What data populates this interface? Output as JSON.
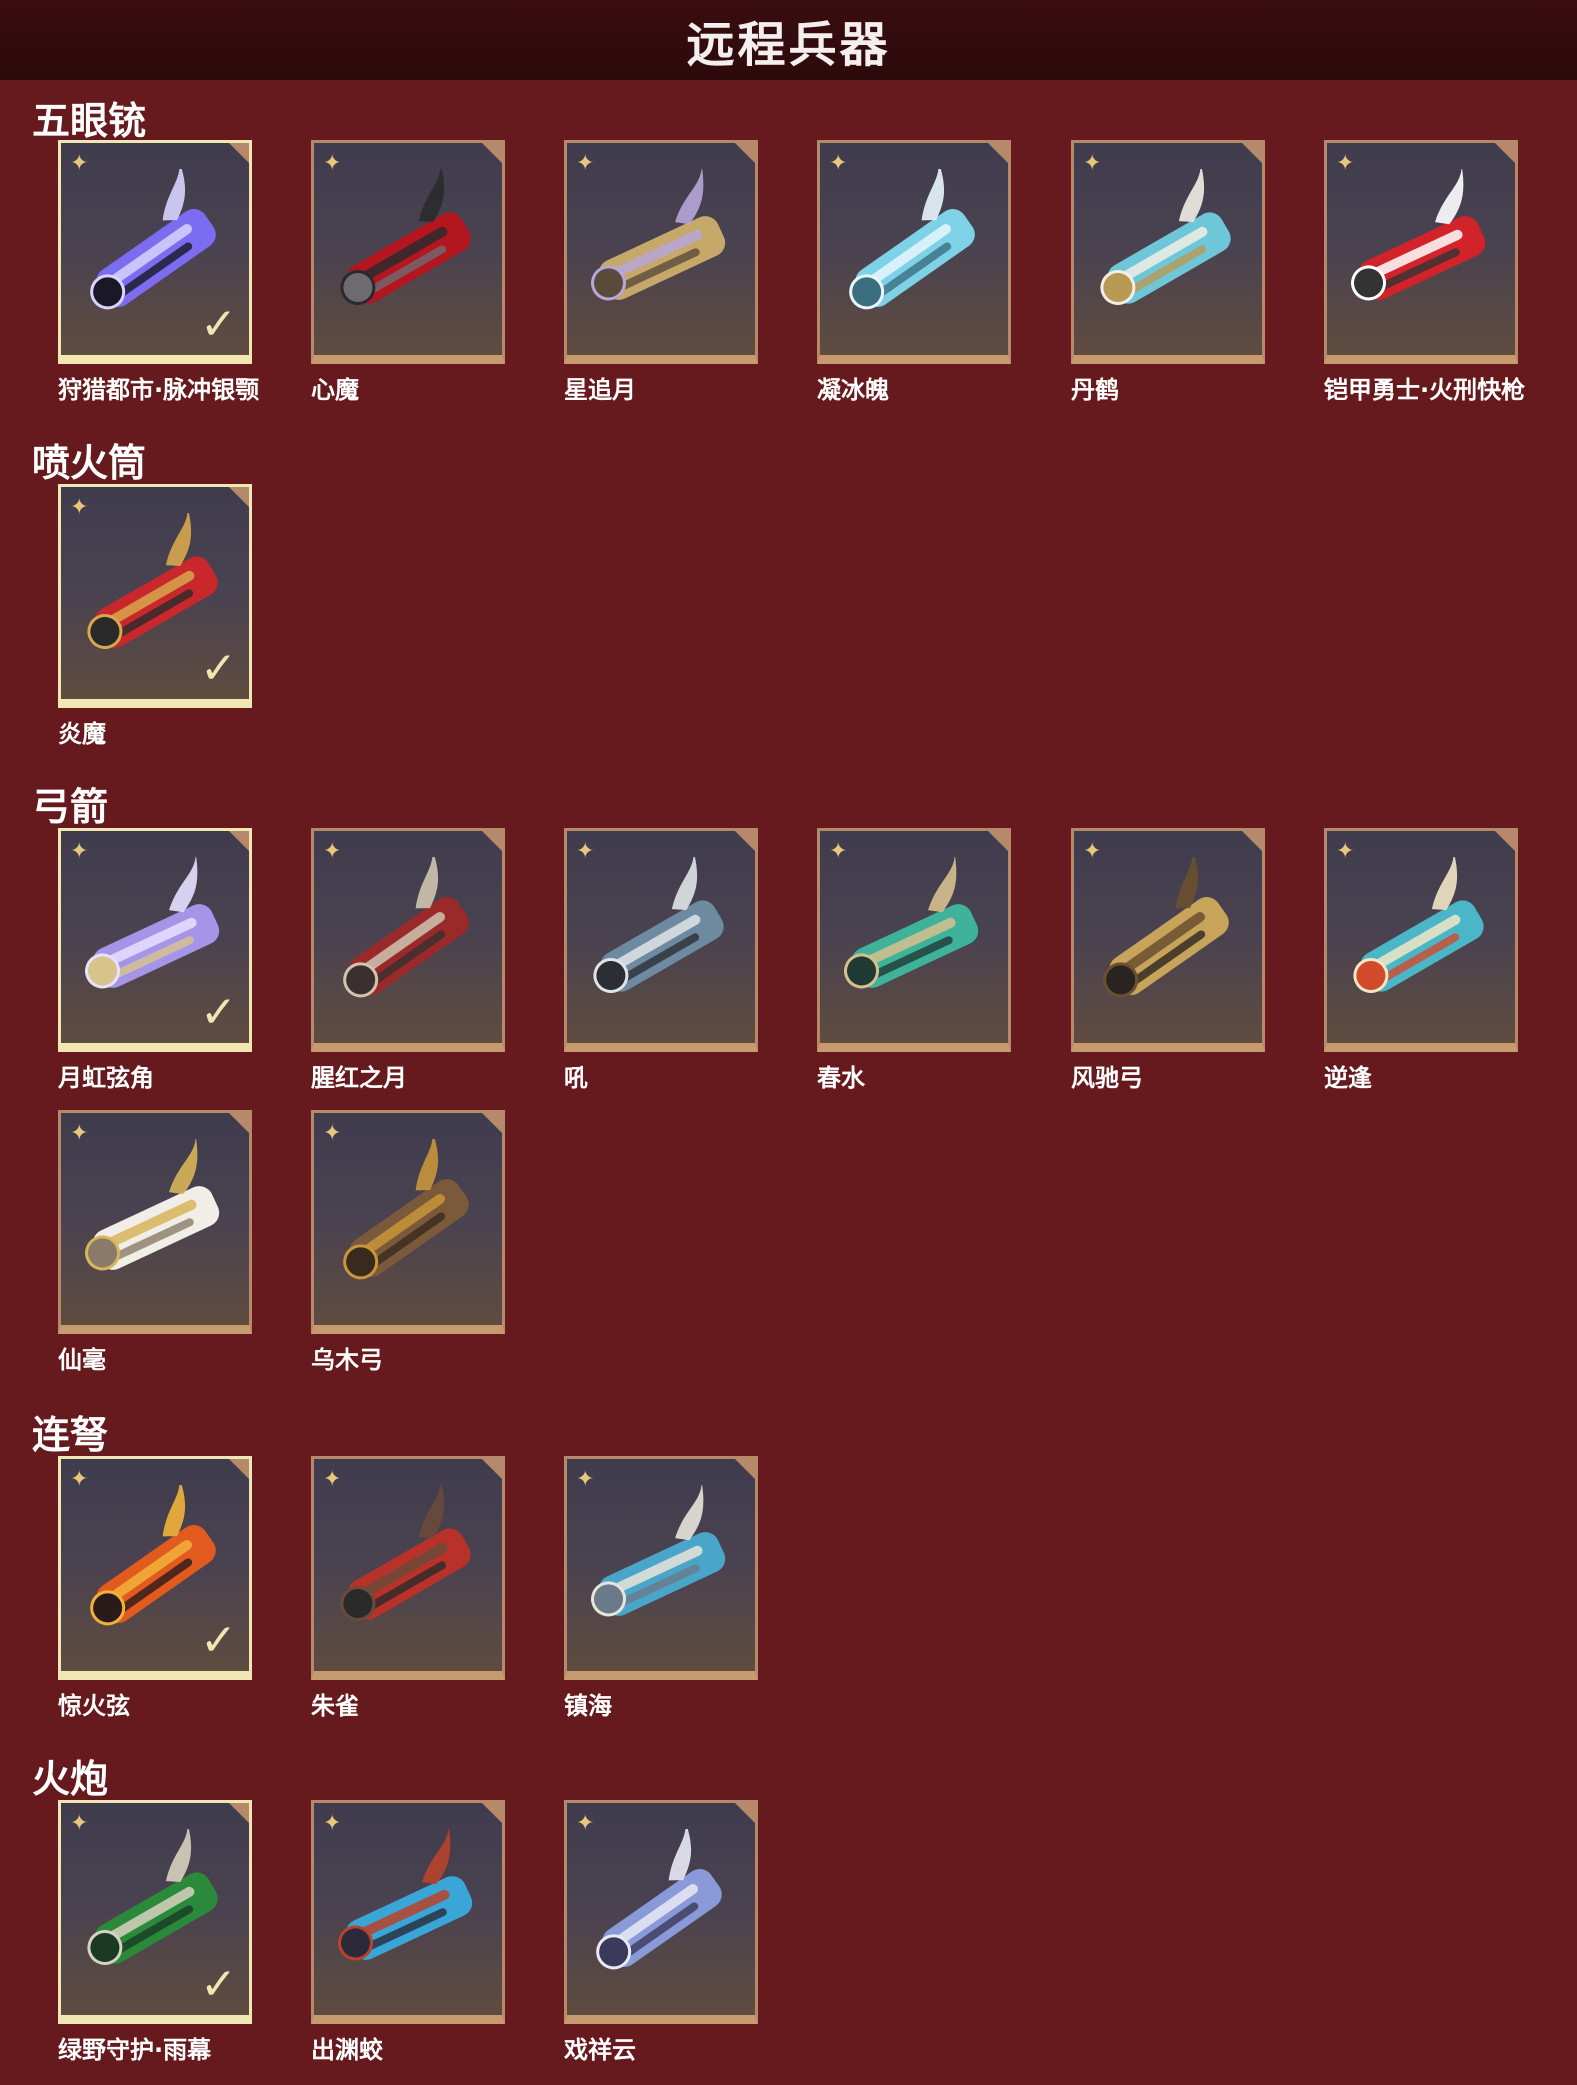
{
  "title": "远程兵器",
  "categories": [
    {
      "name": "五眼铳",
      "items": [
        {
          "label": "狩猎都市·脉冲银颚",
          "selected": true,
          "colors": [
            "#7b6cf0",
            "#d8d4ff",
            "#1a1826"
          ]
        },
        {
          "label": "心魔",
          "selected": false,
          "colors": [
            "#b3161f",
            "#2a2a2e",
            "#6d6b70"
          ]
        },
        {
          "label": "星追月",
          "selected": false,
          "colors": [
            "#c6a96a",
            "#b7a6d8",
            "#5a4a3a"
          ]
        },
        {
          "label": "凝冰魄",
          "selected": false,
          "colors": [
            "#7ed2e8",
            "#e8f6fb",
            "#3b6f80"
          ]
        },
        {
          "label": "丹鹤",
          "selected": false,
          "colors": [
            "#6ec7d8",
            "#f1eee4",
            "#b99a55"
          ]
        },
        {
          "label": "铠甲勇士·火刑快枪",
          "selected": false,
          "colors": [
            "#d2232a",
            "#ffffff",
            "#333333"
          ]
        }
      ]
    },
    {
      "name": "喷火筒",
      "items": [
        {
          "label": "炎魔",
          "selected": true,
          "colors": [
            "#c8282c",
            "#d8a64c",
            "#2a2a2a"
          ]
        }
      ]
    },
    {
      "name": "弓箭",
      "items": [
        {
          "label": "月虹弦角",
          "selected": true,
          "colors": [
            "#a694e8",
            "#e6e1ff",
            "#d8c48a"
          ]
        },
        {
          "label": "腥红之月",
          "selected": false,
          "colors": [
            "#9a2a2a",
            "#cfc4b0",
            "#3a3030"
          ]
        },
        {
          "label": "吼",
          "selected": false,
          "colors": [
            "#6d8aa0",
            "#e0e4e8",
            "#2c2e34"
          ]
        },
        {
          "label": "春水",
          "selected": false,
          "colors": [
            "#3fb39a",
            "#d6c08e",
            "#213a34"
          ]
        },
        {
          "label": "风驰弓",
          "selected": false,
          "colors": [
            "#c8a35a",
            "#6a5030",
            "#2a2420"
          ]
        },
        {
          "label": "逆逢",
          "selected": false,
          "colors": [
            "#4bb6c8",
            "#f2e6c4",
            "#d24a2a"
          ]
        },
        {
          "label": "仙毫",
          "selected": false,
          "colors": [
            "#f0eee6",
            "#d8b45a",
            "#8a7a6a"
          ]
        },
        {
          "label": "乌木弓",
          "selected": false,
          "colors": [
            "#7a5a3a",
            "#c8953a",
            "#3a2a1e"
          ]
        }
      ]
    },
    {
      "name": "连弩",
      "items": [
        {
          "label": "惊火弦",
          "selected": true,
          "colors": [
            "#e25a1e",
            "#f2b23a",
            "#2a1a1a"
          ]
        },
        {
          "label": "朱雀",
          "selected": false,
          "colors": [
            "#b8322a",
            "#6a4a3a",
            "#2a2a2a"
          ]
        },
        {
          "label": "镇海",
          "selected": false,
          "colors": [
            "#4aa6c8",
            "#e8e4da",
            "#6a7a8a"
          ]
        }
      ]
    },
    {
      "name": "火炮",
      "items": [
        {
          "label": "绿野守护·雨幕",
          "selected": true,
          "colors": [
            "#2a8a3a",
            "#d8d0c0",
            "#1a3a24"
          ]
        },
        {
          "label": "出渊蛟",
          "selected": false,
          "colors": [
            "#3aa6d8",
            "#b8422a",
            "#2a2a3a"
          ]
        },
        {
          "label": "戏祥云",
          "selected": false,
          "colors": [
            "#8a9ad8",
            "#e8eaf4",
            "#3a3a5a"
          ]
        }
      ]
    }
  ]
}
